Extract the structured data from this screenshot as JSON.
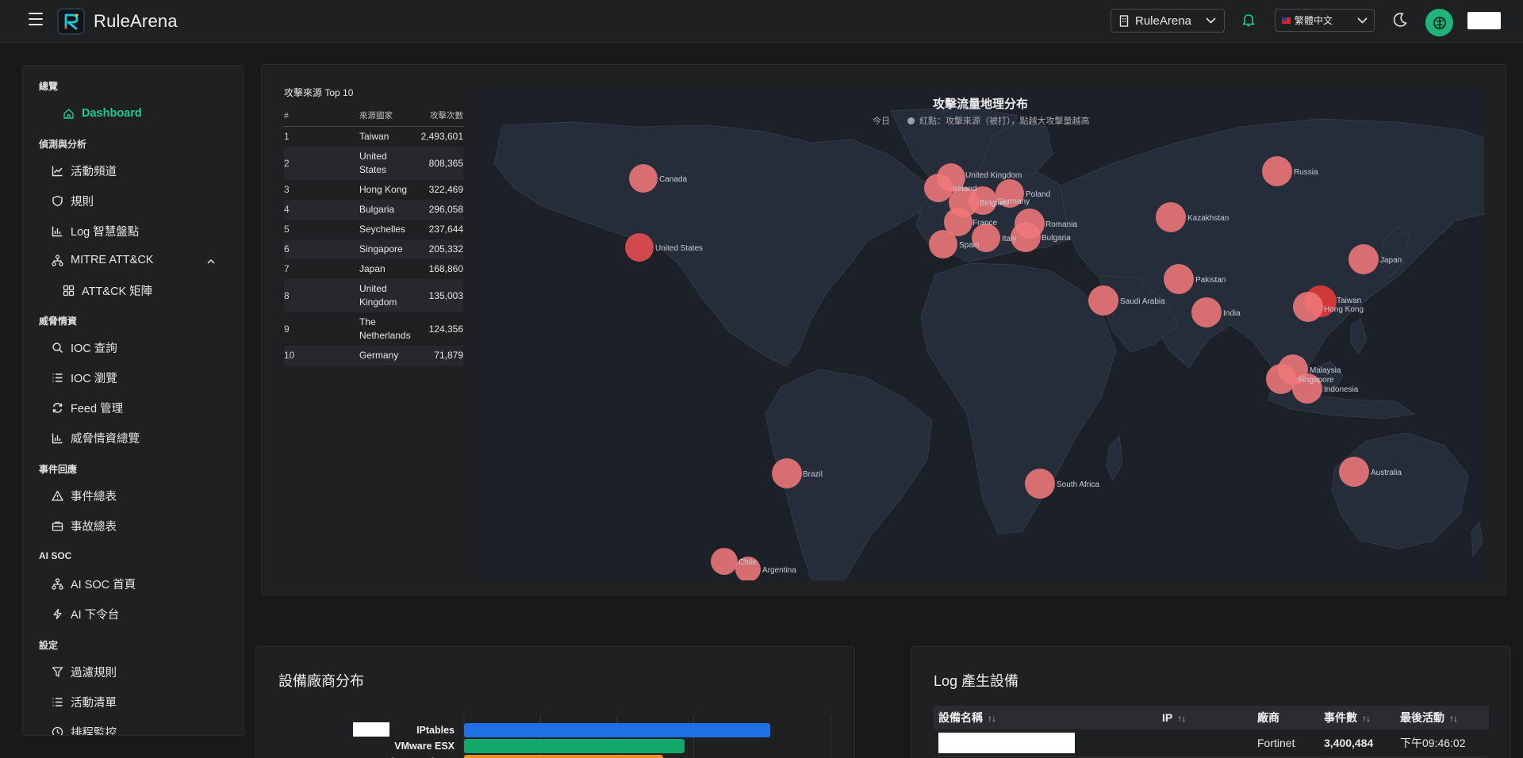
{
  "header": {
    "brand": "RuleArena",
    "tenant": "RuleArena",
    "language": "繁體中文"
  },
  "sidebar": {
    "sections": [
      {
        "title": "總覽"
      },
      {
        "title": "偵測與分析"
      },
      {
        "title": "威脅情資"
      },
      {
        "title": "事件回應"
      },
      {
        "title": "AI SOC"
      },
      {
        "title": "設定"
      }
    ],
    "items": [
      {
        "label": "Dashboard",
        "icon": "home-icon"
      },
      {
        "label": "活動頻道",
        "icon": "trend-icon"
      },
      {
        "label": "規則",
        "icon": "shield-icon"
      },
      {
        "label": "Log 智慧盤點",
        "icon": "bar-chart-icon"
      },
      {
        "label": "MITRE ATT&CK",
        "icon": "network-icon"
      },
      {
        "label": "ATT&CK 矩陣",
        "icon": "grid-icon"
      },
      {
        "label": "IOC 查詢",
        "icon": "search-icon"
      },
      {
        "label": "IOC 瀏覽",
        "icon": "list-icon"
      },
      {
        "label": "Feed 管理",
        "icon": "refresh-icon"
      },
      {
        "label": "威脅情資總覽",
        "icon": "bar-chart-icon"
      },
      {
        "label": "事件總表",
        "icon": "alert-icon"
      },
      {
        "label": "事故總表",
        "icon": "briefcase-icon"
      },
      {
        "label": "AI SOC 首頁",
        "icon": "network-icon"
      },
      {
        "label": "AI 下令台",
        "icon": "bolt-icon"
      },
      {
        "label": "過濾規則",
        "icon": "filter-icon"
      },
      {
        "label": "活動清單",
        "icon": "list-icon"
      },
      {
        "label": "排程監控",
        "icon": "clock-icon"
      }
    ]
  },
  "attack_map": {
    "top10_title": "攻擊來源 Top 10",
    "columns": [
      "#",
      "來源國家",
      "攻擊次數"
    ],
    "rows": [
      {
        "rank": "1",
        "country": "Taiwan",
        "count": "2,493,601"
      },
      {
        "rank": "2",
        "country": "United States",
        "count": "808,365"
      },
      {
        "rank": "3",
        "country": "Hong Kong",
        "count": "322,469"
      },
      {
        "rank": "4",
        "country": "Bulgaria",
        "count": "296,058"
      },
      {
        "rank": "5",
        "country": "Seychelles",
        "count": "237,644"
      },
      {
        "rank": "6",
        "country": "Singapore",
        "count": "205,332"
      },
      {
        "rank": "7",
        "country": "Japan",
        "count": "168,860"
      },
      {
        "rank": "8",
        "country": "United Kingdom",
        "count": "135,003"
      },
      {
        "rank": "9",
        "country": "The Netherlands",
        "count": "124,356"
      },
      {
        "rank": "10",
        "country": "Germany",
        "count": "71,879"
      }
    ],
    "map_title": "攻擊流量地理分布",
    "legend_period": "今日",
    "legend_text": "紅點：攻擊來源（被打），點越大攻擊量越高",
    "map_labels": [
      "Canada",
      "United States",
      "Brazil",
      "Chile",
      "Argentina",
      "Ireland",
      "United Kingdom",
      "Belgium",
      "Germany",
      "Poland",
      "France",
      "Spain",
      "Italy",
      "Romania",
      "Bulgaria",
      "Russia",
      "Kazakhstan",
      "Pakistan",
      "Saudi Arabia",
      "India",
      "Japan",
      "Taiwan",
      "Hong Kong",
      "Malaysia",
      "Singapore",
      "Indonesia",
      "Australia",
      "South Africa"
    ]
  },
  "vendor_dist": {
    "title": "設備廠商分布",
    "chart_data": {
      "type": "bar",
      "orientation": "horizontal",
      "categories": [
        "IPtables",
        "VMware ESX",
        "Fortinet Fortigate"
      ],
      "values": [
        100,
        72,
        65
      ],
      "colors": [
        "#1f6fe5",
        "#12a86a",
        "#f28a25"
      ],
      "xlabel": "",
      "ylabel": ""
    }
  },
  "log_devices": {
    "title": "Log 產生設備",
    "columns": [
      "設備名稱",
      "IP",
      "廠商",
      "事件數",
      "最後活動"
    ],
    "rows": [
      {
        "name": "",
        "ip": "",
        "vendor": "Fortinet",
        "events": "3,400,484",
        "last": "下午09:46:02"
      }
    ]
  },
  "colors": {
    "accent": "#1fcb8f",
    "map_bubble": "#f0787a",
    "map_bg": "#1c2028",
    "land": "#262d3a"
  }
}
